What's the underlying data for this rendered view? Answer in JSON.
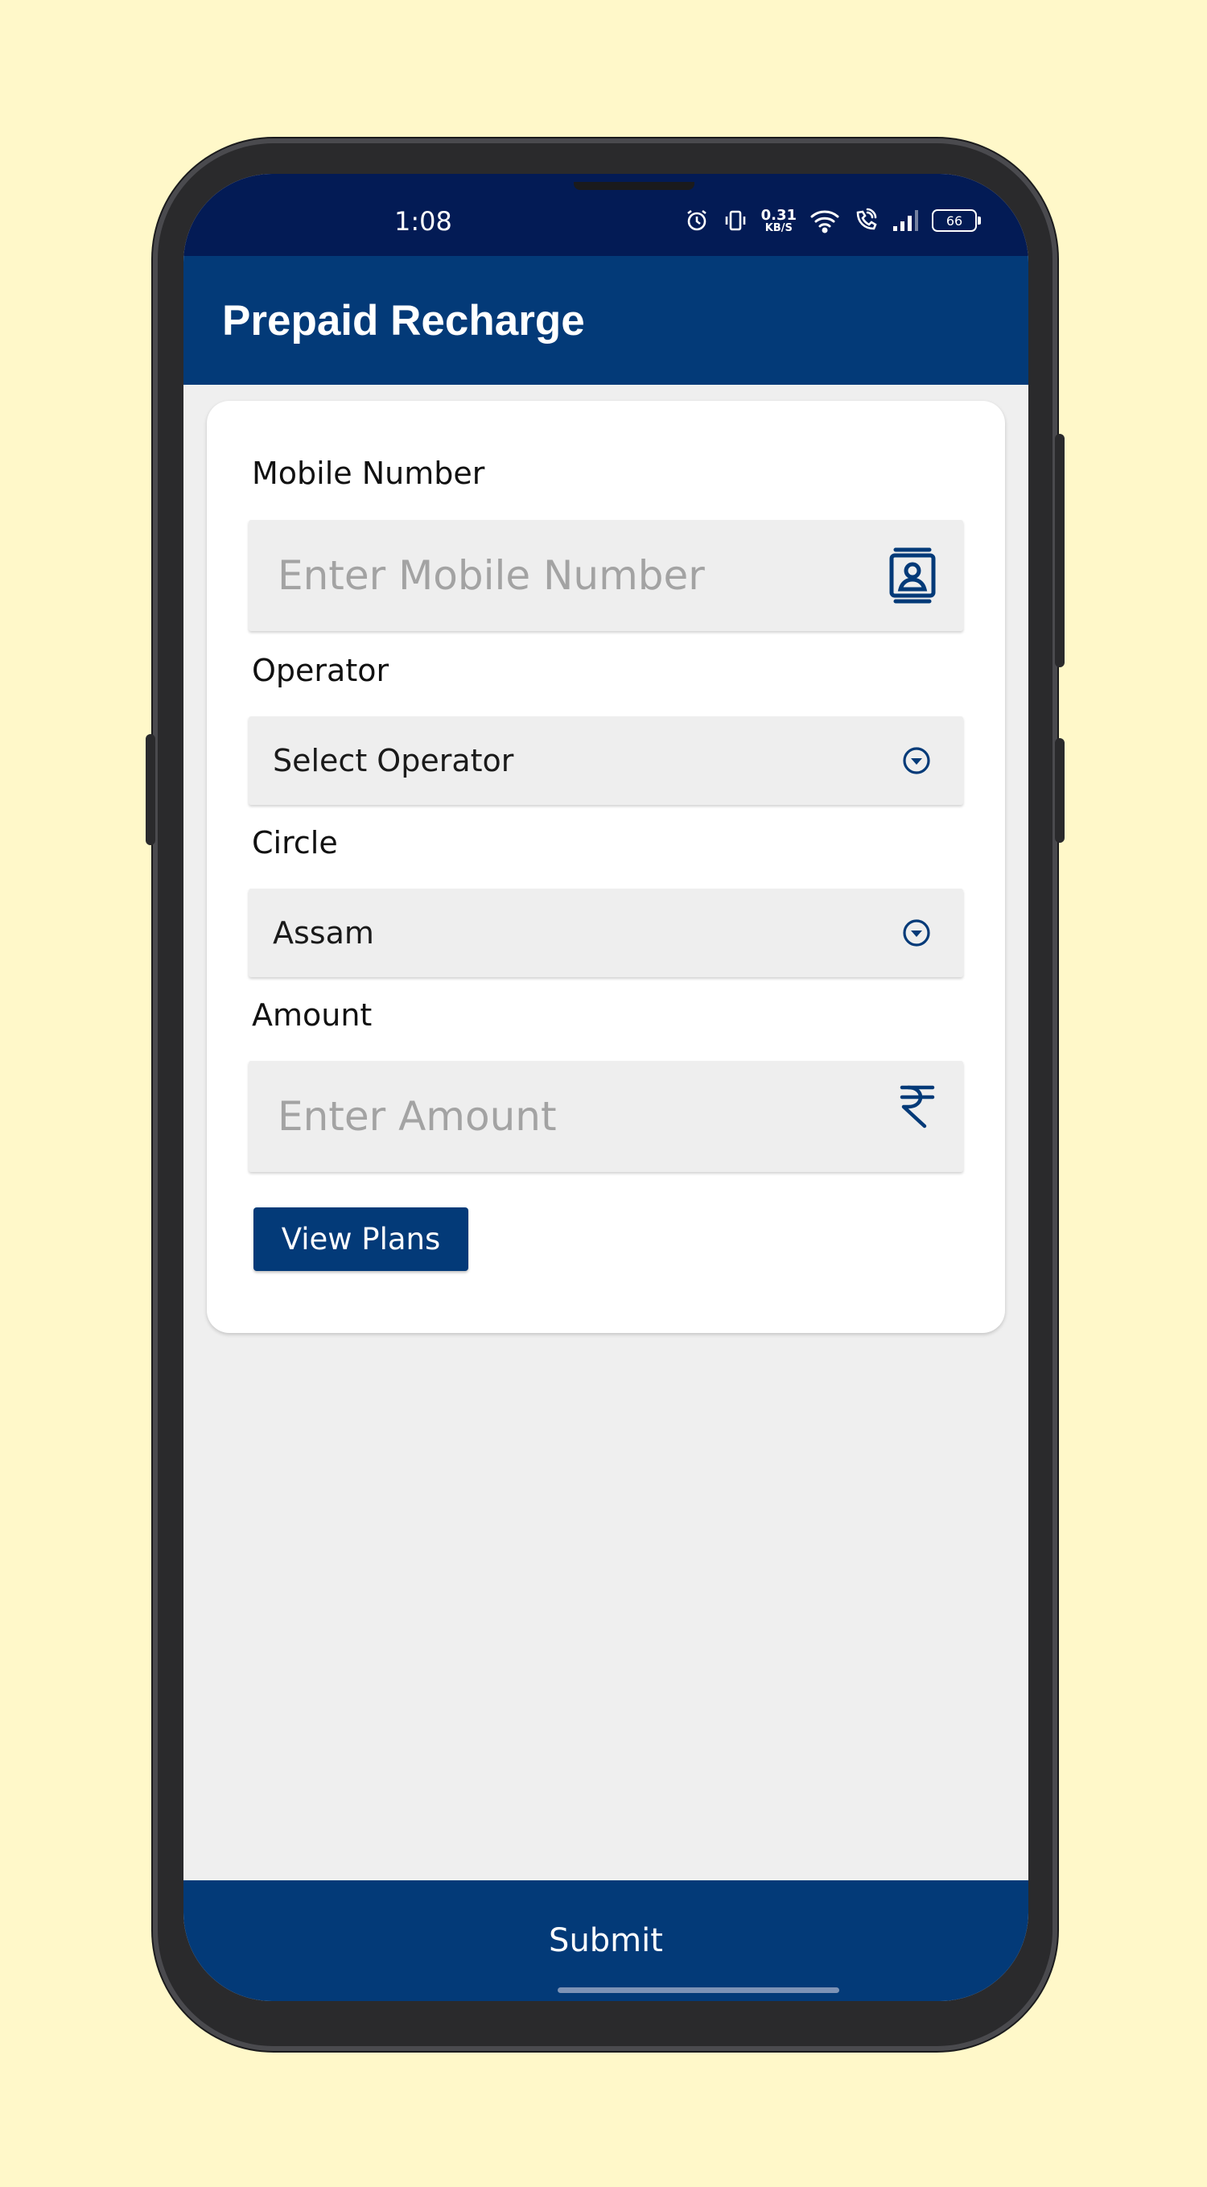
{
  "status_bar": {
    "time": "1:08",
    "net_speed_value": "0.31",
    "net_speed_unit": "KB/S",
    "battery": "66",
    "icons": [
      "alarm-icon",
      "vibrate-icon",
      "wifi-icon",
      "wifi-call-icon",
      "signal-icon",
      "battery-icon"
    ]
  },
  "app_bar": {
    "title": "Prepaid Recharge"
  },
  "form": {
    "mobile": {
      "label": "Mobile Number",
      "placeholder": "Enter Mobile Number",
      "value": "",
      "icon": "contacts-icon"
    },
    "operator": {
      "label": "Operator",
      "selected": "Select Operator",
      "icon": "dropdown-icon"
    },
    "circle": {
      "label": "Circle",
      "selected": "Assam",
      "icon": "dropdown-icon"
    },
    "amount": {
      "label": "Amount",
      "placeholder": "Enter Amount",
      "value": "",
      "icon": "rupee-icon"
    },
    "view_plans_label": "View Plans"
  },
  "footer": {
    "submit_label": "Submit"
  },
  "colors": {
    "primary": "#033a78",
    "status_bar": "#031b55",
    "background": "#fff8c9",
    "screen_bg": "#efefef",
    "field_bg": "#eeeeee"
  }
}
